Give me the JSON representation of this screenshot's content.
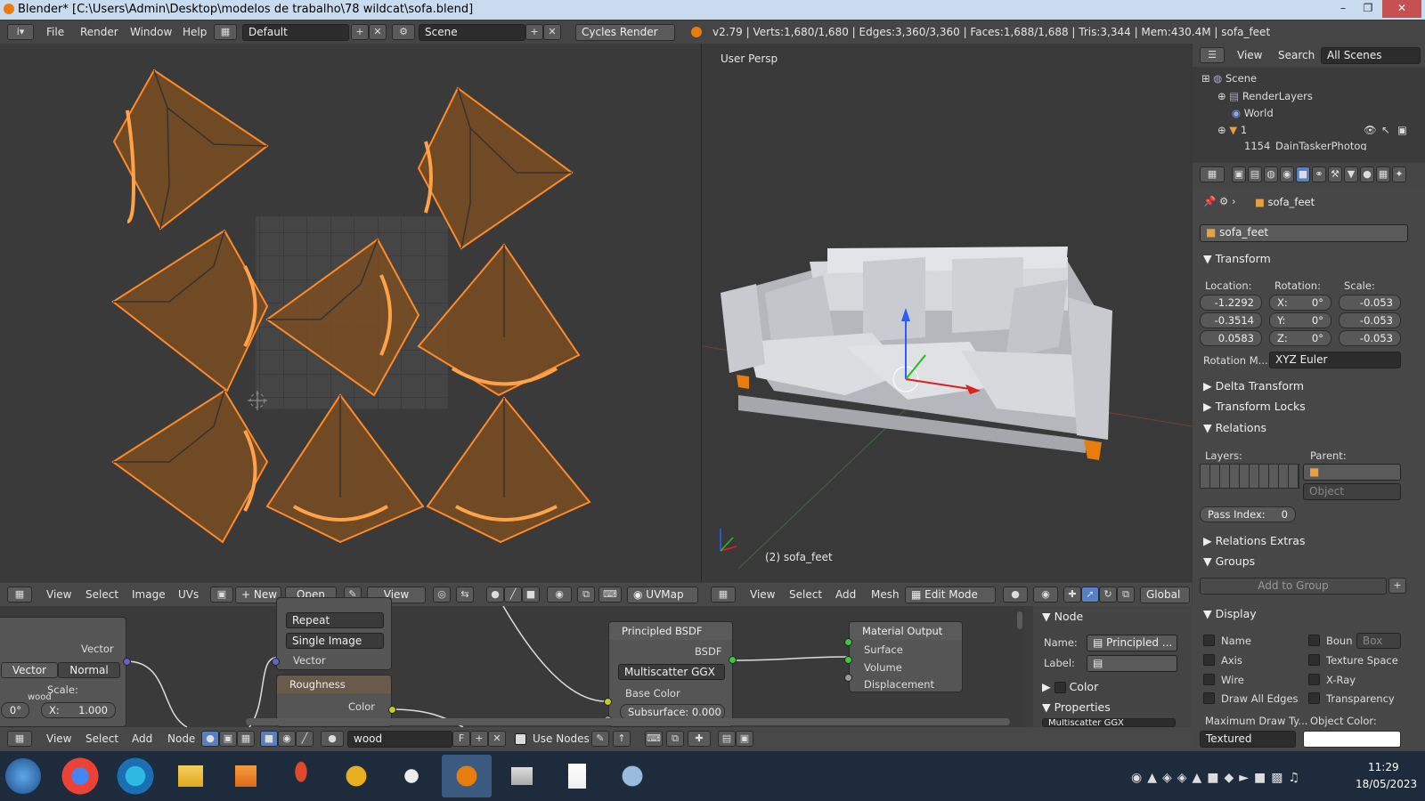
{
  "window": {
    "title": "Blender* [C:\\Users\\Admin\\Desktop\\modelos de trabalho\\78 wildcat\\sofa.blend]"
  },
  "menu": {
    "items": [
      "File",
      "Render",
      "Window",
      "Help"
    ],
    "layout": "Default",
    "scene": "Scene",
    "engine": "Cycles Render",
    "stats": "v2.79 | Verts:1,680/1,680 | Edges:3,360/3,360 | Faces:1,688/1,688 | Tris:3,344 | Mem:430.4M | sofa_feet"
  },
  "uv_editor": {
    "menu": [
      "View",
      "Select",
      "Image",
      "UVs"
    ],
    "new_label": "New",
    "open_label": "Open",
    "view_label": "View",
    "uvmap": "UVMap"
  },
  "viewport": {
    "label": "User Persp",
    "object_label": "(2) sofa_feet",
    "menu": [
      "View",
      "Select",
      "Add",
      "Mesh"
    ],
    "mode": "Edit Mode",
    "orientation": "Global"
  },
  "outliner": {
    "menu": [
      "View",
      "Search"
    ],
    "scope": "All Scenes",
    "items": [
      "Scene",
      "RenderLayers",
      "World",
      "1",
      "1154_DainTaskerPhotog"
    ]
  },
  "properties": {
    "breadcrumb": "sofa_feet",
    "object_name": "sofa_feet",
    "transform": {
      "title": "Transform",
      "location_label": "Location:",
      "rotation_label": "Rotation:",
      "scale_label": "Scale:",
      "location": [
        "-1.2292",
        "-0.3514",
        "0.0583"
      ],
      "rotation": [
        "X:",
        "0°",
        "Y:",
        "0°",
        "Z:",
        "0°"
      ],
      "scale": [
        "-0.053",
        "-0.053",
        "-0.053"
      ],
      "rotation_mode_label": "Rotation M...",
      "rotation_mode": "XYZ Euler"
    },
    "sections": [
      "Delta Transform",
      "Transform Locks",
      "Relations",
      "Relations Extras",
      "Groups",
      "Display"
    ],
    "relations": {
      "layers_label": "Layers:",
      "parent_label": "Parent:",
      "parent_type": "Object",
      "pass_index_label": "Pass Index:",
      "pass_index": "0"
    },
    "groups_add": "Add to Group",
    "display": {
      "left": [
        "Name",
        "Axis",
        "Wire",
        "Draw All Edges"
      ],
      "right": [
        "Boun",
        "Texture Space",
        "X-Ray",
        "Transparency"
      ],
      "bounds_type": "Box",
      "max_draw_label": "Maximum Draw Ty...",
      "max_draw": "Textured",
      "object_color_label": "Object Color:"
    }
  },
  "node_editor": {
    "nodes": {
      "mapping": {
        "vector": "Vector",
        "tabs": [
          "Vector",
          "Normal"
        ],
        "scale": "Scale:",
        "x": "X:",
        "x_val": "1.000",
        "rot": "0°",
        "tag": "wood"
      },
      "image": {
        "repeat": "Repeat",
        "single": "Single Image",
        "vector": "Vector"
      },
      "roughness": {
        "title": "Roughness",
        "color": "Color"
      },
      "principled": {
        "title": "Principled BSDF",
        "bsdf": "BSDF",
        "dist": "Multiscatter GGX",
        "base_color": "Base Color",
        "subsurface": "Subsurface:",
        "subsurface_val": "0.000"
      },
      "output": {
        "title": "Material Output",
        "surface": "Surface",
        "volume": "Volume",
        "displacement": "Displacement"
      }
    },
    "side": {
      "node_title": "Node",
      "name_label": "Name:",
      "name_value": "Principled ...",
      "label_label": "Label:",
      "color": "Color",
      "properties": "Properties",
      "dist": "Multiscatter GGX"
    },
    "footer": {
      "menu": [
        "View",
        "Select",
        "Add",
        "Node"
      ],
      "material": "wood",
      "f_label": "F",
      "use_nodes": "Use Nodes"
    }
  },
  "taskbar": {
    "time": "11:29",
    "date": "18/05/2023"
  }
}
